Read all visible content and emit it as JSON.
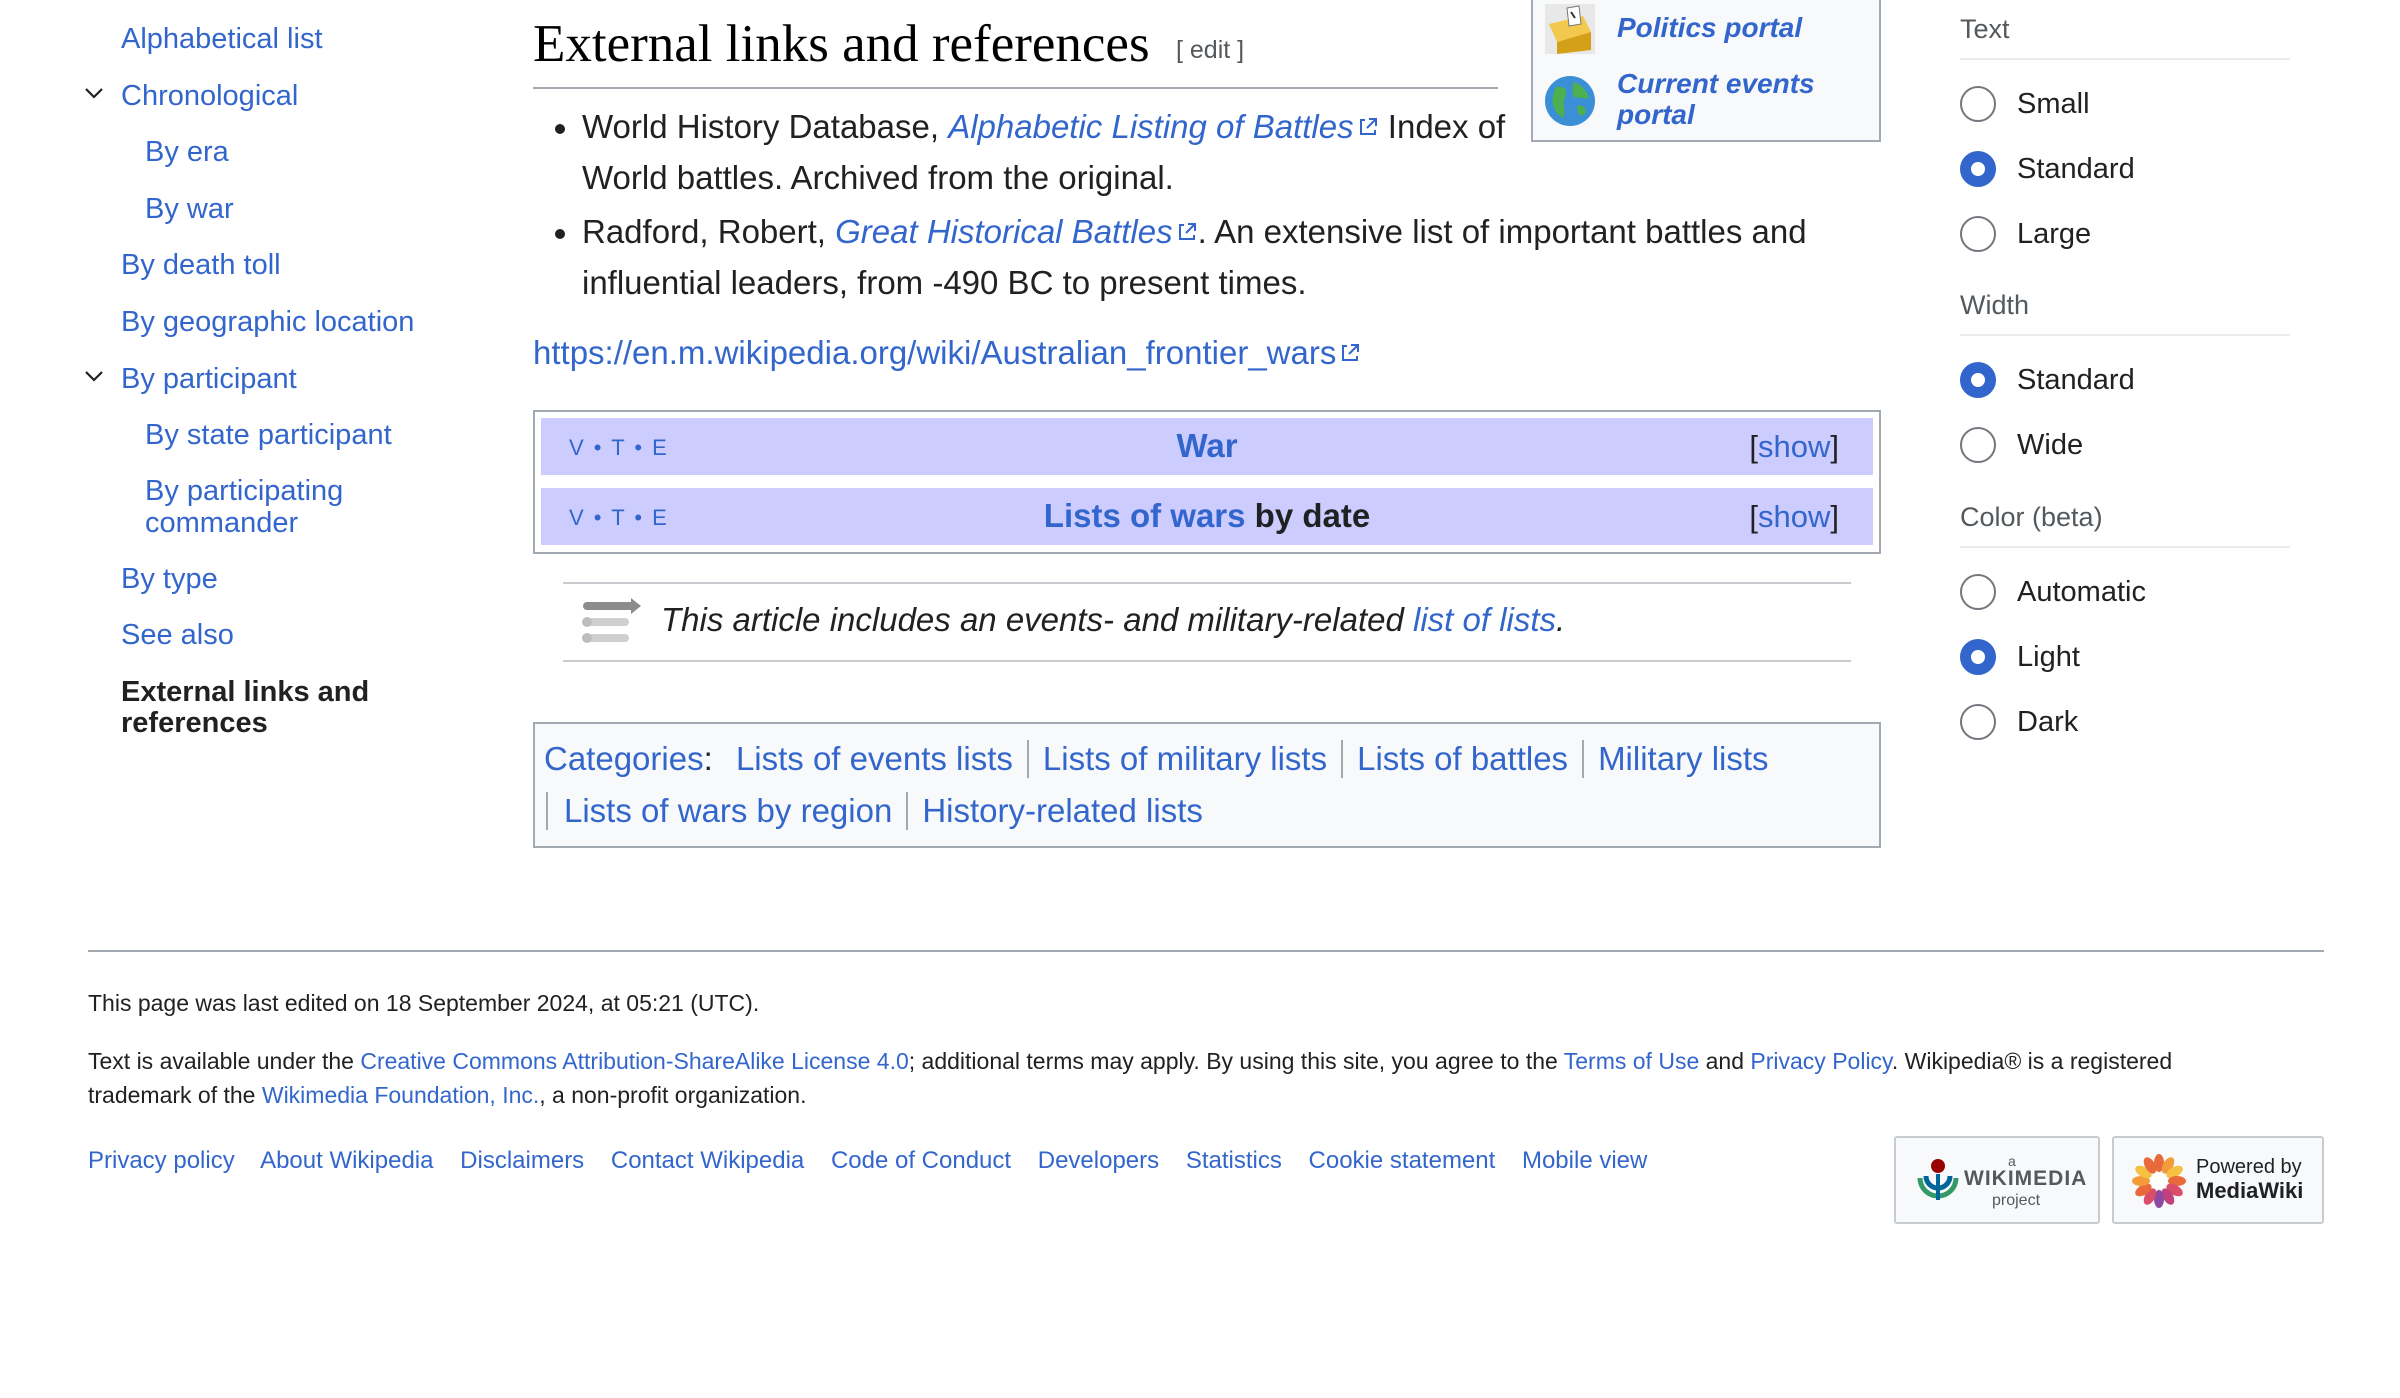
{
  "toc": {
    "items": [
      {
        "label": "Alphabetical list"
      },
      {
        "label": "Chronological"
      },
      {
        "label": "By era"
      },
      {
        "label": "By war"
      },
      {
        "label": "By death toll"
      },
      {
        "label": "By geographic location"
      },
      {
        "label": "By participant"
      },
      {
        "label": "By state participant"
      },
      {
        "label": "By participating"
      },
      {
        "label": "commander"
      },
      {
        "label": "By type"
      },
      {
        "label": "See also"
      },
      {
        "label": "External links and"
      },
      {
        "label": "references"
      }
    ]
  },
  "section": {
    "heading": "External links and references",
    "edit_label": "[ edit ]"
  },
  "portals": [
    {
      "label": "Politics portal"
    },
    {
      "label": "Current events"
    },
    {
      "label": "portal"
    }
  ],
  "references": [
    {
      "prefix": "World History Database, ",
      "link": "Alphabetic Listing of Battles",
      "suffix_line1": " Index of",
      "line2": "World battles. Archived from the original."
    },
    {
      "prefix": "Radford, Robert, ",
      "link": "Great Historical Battles",
      "suffix_line1": ". An extensive list of important battles and",
      "line2": "influential leaders, from -490 BC to present times."
    }
  ],
  "external_url": "https://en.m.wikipedia.org/wiki/Australian_frontier_wars",
  "navboxes": [
    {
      "vte": "V • T • E",
      "title_link": "War",
      "title_rest": "",
      "show": "show"
    },
    {
      "vte": "V • T • E",
      "title_link": "Lists of wars",
      "title_rest": " by date",
      "show": "show"
    }
  ],
  "list_note": {
    "prefix": "This article includes an events- and military-related ",
    "link": "list of lists",
    "suffix": "."
  },
  "categories": {
    "label": "Categories",
    "line1": [
      "Lists of events lists",
      "Lists of military lists",
      "Lists of battles",
      "Military lists"
    ],
    "line2": [
      "Lists of wars by region",
      "History-related lists"
    ]
  },
  "appearance": {
    "text_heading": "Text",
    "text_options": [
      {
        "label": "Small",
        "selected": false
      },
      {
        "label": "Standard",
        "selected": true
      },
      {
        "label": "Large",
        "selected": false
      }
    ],
    "width_heading": "Width",
    "width_options": [
      {
        "label": "Standard",
        "selected": true
      },
      {
        "label": "Wide",
        "selected": false
      }
    ],
    "color_heading": "Color (beta)",
    "color_options": [
      {
        "label": "Automatic",
        "selected": false
      },
      {
        "label": "Light",
        "selected": true
      },
      {
        "label": "Dark",
        "selected": false
      }
    ]
  },
  "footer": {
    "last_edited": "This page was last edited on 18 September 2024, at 05:21 (UTC).",
    "license_a": "Text is available under the ",
    "license_link": "Creative Commons Attribution-ShareAlike License 4.0",
    "license_b": "; additional terms may apply. By using this site, you agree to the ",
    "terms_link": "Terms of Use",
    "license_c": " and ",
    "privacy_link": "Privacy Policy",
    "license_d": ". Wikipedia® is a registered",
    "license_e": "trademark of the ",
    "foundation_link": "Wikimedia Foundation, Inc.",
    "license_f": ", a non-profit organization.",
    "links": [
      "Privacy policy",
      "About Wikipedia",
      "Disclaimers",
      "Contact Wikipedia",
      "Code of Conduct",
      "Developers",
      "Statistics",
      "Cookie statement",
      "Mobile view"
    ],
    "wikimedia_badge": {
      "small": "a",
      "name": "WIKIMEDIA",
      "sub": "project"
    },
    "mediawiki_badge": {
      "line1": "Powered by",
      "line2": "MediaWiki"
    }
  },
  "colors": {
    "link": "#3366cc",
    "navbox_header": "#ccccff",
    "border": "#a2a9b1",
    "radio_selected": "#3366cc"
  }
}
